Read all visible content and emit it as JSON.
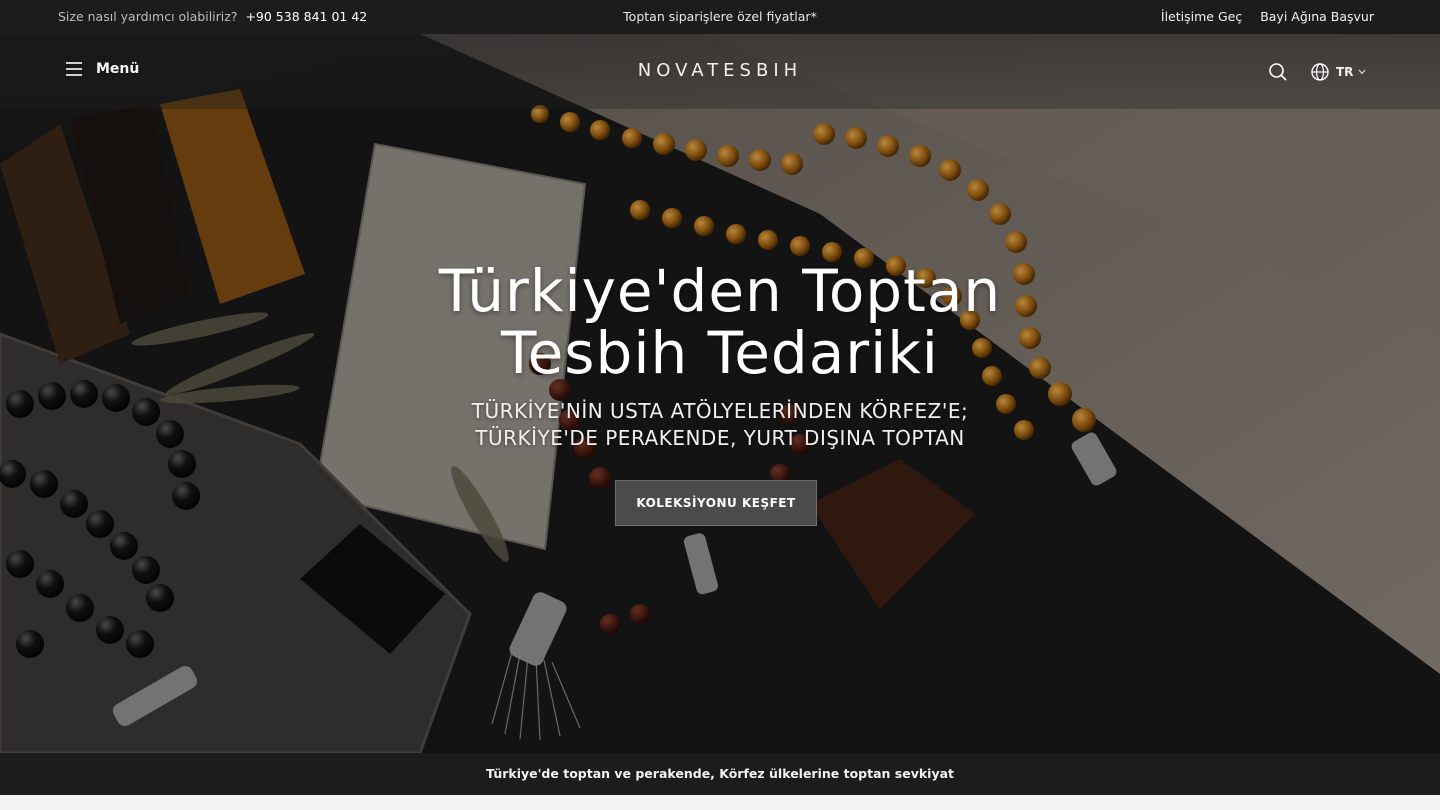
{
  "topbar": {
    "help_text": "Size nasıl yardımcı olabiliriz?",
    "phone": "+90 538 841 01 42",
    "promo": "Toptan siparişlere özel fiyatlar*",
    "links": [
      "İletişime Geç",
      "Bayi Ağına Başvur"
    ]
  },
  "header": {
    "menu_label": "Menü",
    "menu_icon": "hamburger-icon",
    "logo": "NOVATESBIH",
    "search_icon": "search-icon",
    "language_icon": "globe-icon",
    "language": "TR",
    "language_chevron": "chevron-down-icon"
  },
  "hero": {
    "title_line1": "Türkiye'den Toptan",
    "title_line2": "Tesbih Tedariki",
    "subtitle_line1": "TÜRKİYE'NİN USTA ATÖLYELERİNDEN KÖRFEZ'E;",
    "subtitle_line2": "TÜRKİYE'DE PERAKENDE, YURT DIŞINA TOPTAN",
    "cta_label": "KOLEKSİYONU KEŞFET"
  },
  "bottombar": {
    "text": "Türkiye'de toptan ve perakende, Körfez ülkelerine toptan sevkiyat"
  },
  "colors": {
    "bar_background": "#1c1c1c",
    "cta_background": "#505050",
    "text": "#ffffff"
  }
}
